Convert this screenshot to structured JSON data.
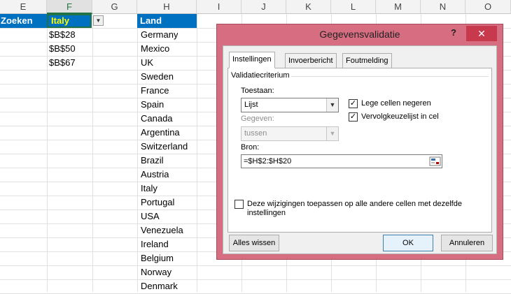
{
  "columns": [
    "E",
    "F",
    "G",
    "H",
    "I",
    "J",
    "K",
    "L",
    "M",
    "N",
    "O"
  ],
  "cells": {
    "e1": "Zoeken",
    "f1": "Italy",
    "f2": "$B$28",
    "f3": "$B$50",
    "f4": "$B$67",
    "h1": "Land",
    "countries": [
      "Germany",
      "Mexico",
      "UK",
      "Sweden",
      "France",
      "Spain",
      "Canada",
      "Argentina",
      "Switzerland",
      "Brazil",
      "Austria",
      "Italy",
      "Portugal",
      "USA",
      "Venezuela",
      "Ireland",
      "Belgium",
      "Norway",
      "Denmark"
    ]
  },
  "colors": {
    "header_blue": "#0070c0",
    "selected_text_yellow": "#ffff00",
    "dialog_frame": "#d66d80",
    "close_button": "#c7394c"
  },
  "dialog": {
    "title": "Gegevensvalidatie",
    "help": "?",
    "close": "✕",
    "tabs": [
      "Instellingen",
      "Invoerbericht",
      "Foutmelding"
    ],
    "group_label": "Validatiecriterium",
    "allow_label": "Toestaan:",
    "allow_value": "Lijst",
    "ignore_blank": "Lege cellen negeren",
    "in_cell_dropdown": "Vervolgkeuzelijst in cel",
    "data_label": "Gegeven:",
    "data_value": "tussen",
    "source_label": "Bron:",
    "source_value": "=$H$2:$H$20",
    "apply_all": "Deze wijzigingen toepassen op alle andere cellen met dezelfde instellingen",
    "clear_all": "Alles wissen",
    "ok": "OK",
    "cancel": "Annuleren"
  }
}
